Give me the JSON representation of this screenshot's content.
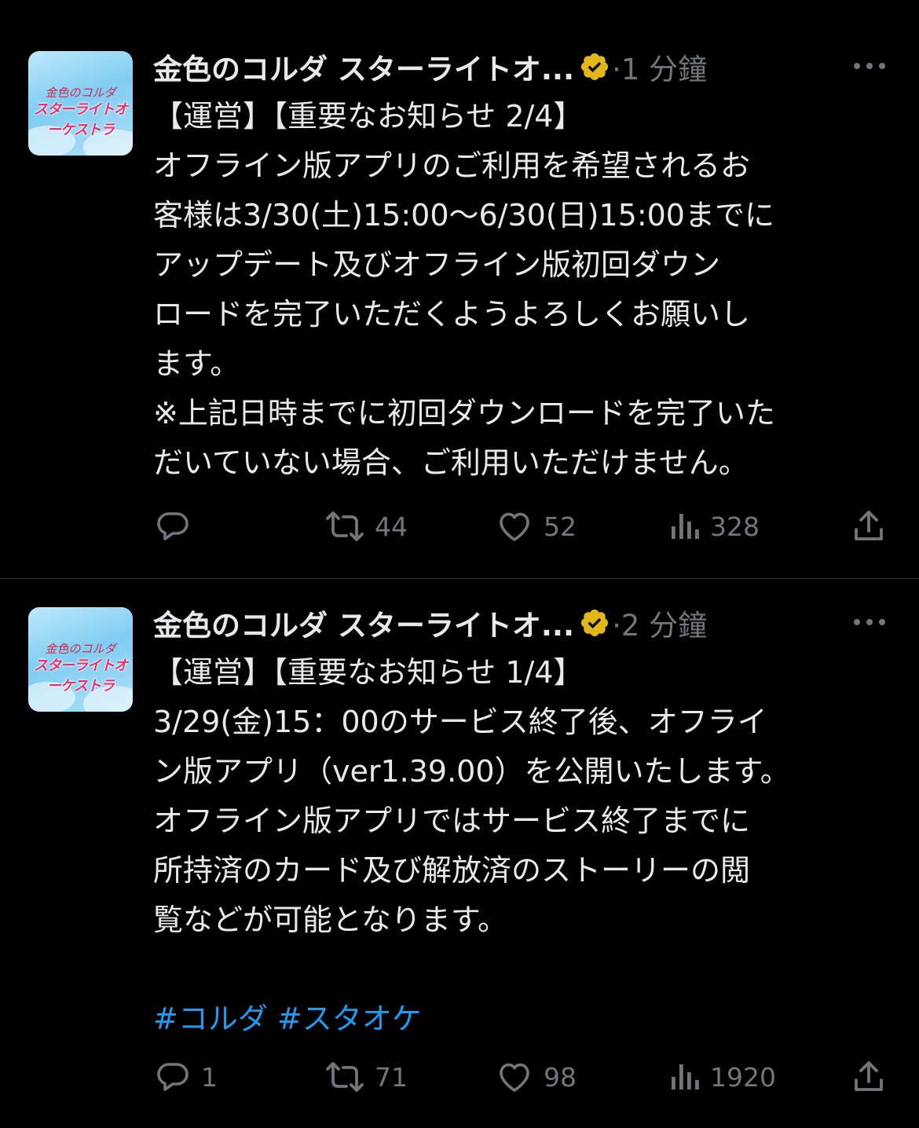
{
  "colors": {
    "background": "#000000",
    "text": "#e7e9ea",
    "secondary": "#71767b",
    "hashtag": "#1d9bf0",
    "verified": "#e2b719",
    "divider": "#2f3336"
  },
  "tweets": [
    {
      "author_name": "金色のコルダ スターライトオ...",
      "verified": true,
      "time": "·1 分鐘",
      "avatar": {
        "logo_line1": "金色のコルダ",
        "logo_line2": "スターライトオーケストラ"
      },
      "lines": [
        "【運営】【重要なお知らせ 2/4】",
        "オフライン版アプリのご利用を希望されるお",
        "客様は3/30(土)15:00～6/30(日)15:00までに",
        "アップデート及びオフライン版初回ダウン",
        "ロードを完了いただくようよろしくお願いし",
        "ます。",
        "※上記日時までに初回ダウンロードを完了いた",
        "だいていない場合、ご利用いただけません。"
      ],
      "stats": {
        "replies": "",
        "retweets": "44",
        "likes": "52",
        "views": "328"
      }
    },
    {
      "author_name": "金色のコルダ スターライトオ...",
      "verified": true,
      "time": "·2 分鐘",
      "avatar": {
        "logo_line1": "金色のコルダ",
        "logo_line2": "スターライトオーケストラ"
      },
      "lines": [
        "【運営】【重要なお知らせ 1/4】",
        "3/29(金)15：00のサービス終了後、オフライ",
        "ン版アプリ（ver1.39.00）を公開いたします。",
        "オフライン版アプリではサービス終了までに",
        "所持済のカード及び解放済のストーリーの閲",
        "覧などが可能となります。"
      ],
      "hashtags": "#コルダ #スタオケ",
      "stats": {
        "replies": "1",
        "retweets": "71",
        "likes": "98",
        "views": "1920"
      }
    }
  ]
}
